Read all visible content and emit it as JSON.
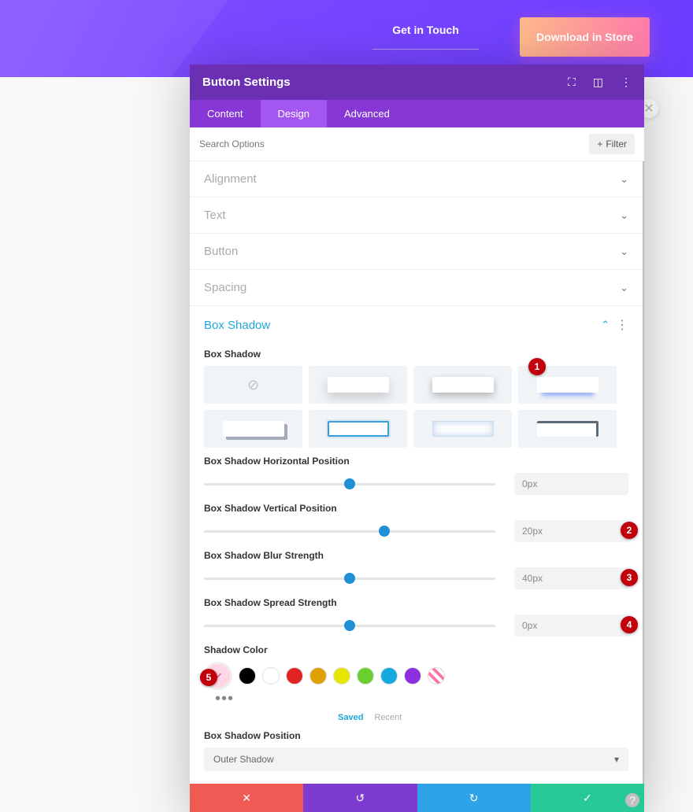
{
  "banner": {
    "link_text": "Get in Touch",
    "cta_label": "Download in Store"
  },
  "panel": {
    "title": "Button Settings",
    "tabs": {
      "content": "Content",
      "design": "Design",
      "advanced": "Advanced"
    },
    "search_placeholder": "Search Options",
    "filter_label": "Filter",
    "accordion": {
      "alignment": "Alignment",
      "text": "Text",
      "button": "Button",
      "spacing": "Spacing",
      "box_shadow": "Box Shadow"
    },
    "box_shadow": {
      "group_label": "Box Shadow",
      "sliders": {
        "horizontal": {
          "label": "Box Shadow Horizontal Position",
          "value": "0px"
        },
        "vertical": {
          "label": "Box Shadow Vertical Position",
          "value": "20px"
        },
        "blur": {
          "label": "Box Shadow Blur Strength",
          "value": "40px"
        },
        "spread": {
          "label": "Box Shadow Spread Strength",
          "value": "0px"
        }
      },
      "shadow_color_label": "Shadow Color",
      "color_tabs": {
        "saved": "Saved",
        "recent": "Recent"
      },
      "position_label": "Box Shadow Position",
      "position_value": "Outer Shadow"
    }
  },
  "colors": {
    "swatches": [
      "#000000",
      "#ffffff",
      "#e02424",
      "#e0a100",
      "#e6e600",
      "#6bcf2e",
      "#14a9e0",
      "#8b2fe0"
    ],
    "striped": true
  },
  "annotations": {
    "a1": "1",
    "a2": "2",
    "a3": "3",
    "a4": "4",
    "a5": "5"
  }
}
